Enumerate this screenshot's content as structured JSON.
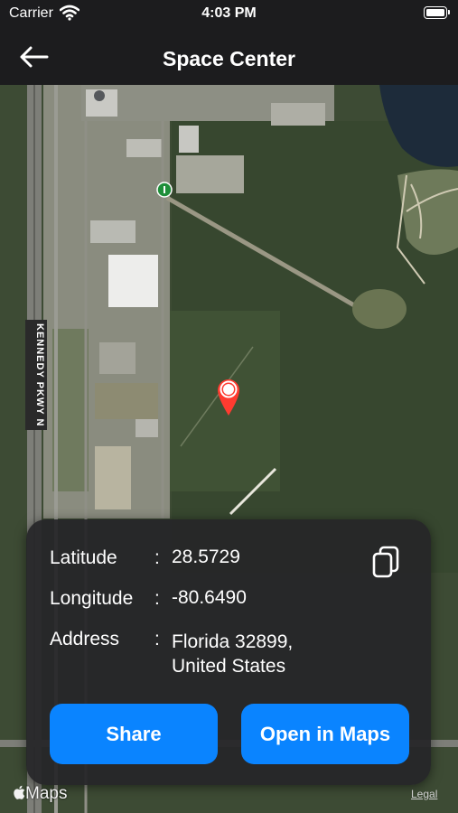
{
  "status_bar": {
    "carrier": "Carrier",
    "time": "4:03 PM"
  },
  "nav": {
    "title": "Space Center",
    "back_icon": "arrow-left-icon"
  },
  "map": {
    "road_label": "KENNEDY PKWY N",
    "pin_color": "#ff3b30"
  },
  "info": {
    "latitude_label": "Latitude",
    "latitude_value": "28.5729",
    "longitude_label": "Longitude",
    "longitude_value": "-80.6490",
    "address_label": "Address",
    "address_line1": "Florida 32899,",
    "address_line2": "United States",
    "colon": ":"
  },
  "actions": {
    "share_label": "Share",
    "open_maps_label": "Open in Maps"
  },
  "footer": {
    "maps_label": "Maps",
    "legal_label": "Legal"
  },
  "colors": {
    "accent": "#0a84ff",
    "card_bg": "#262628",
    "bar_bg": "#1c1c1e"
  }
}
